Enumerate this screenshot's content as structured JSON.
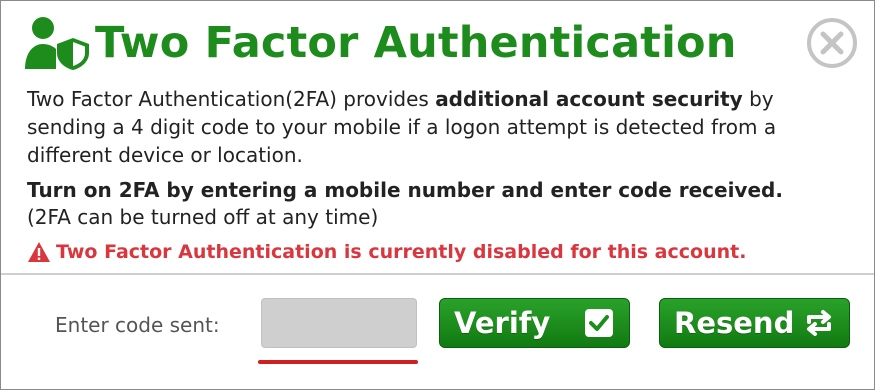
{
  "dialog": {
    "title": "Two Factor Authentication",
    "header_icon": "user-shield-icon",
    "close_icon": "close-circle-icon"
  },
  "description": {
    "part1": "Two Factor Authentication(2FA) provides ",
    "bold1": "additional account security",
    "part2": " by sending a 4 digit code to your mobile if a logon attempt is detected from a different device or location."
  },
  "instructions": {
    "bold": "Turn on 2FA by entering a mobile number and enter code received.",
    "note": "(2FA can be turned off at any time)"
  },
  "warning": {
    "icon": "warning-triangle-icon",
    "text": "Two Factor Authentication is currently disabled for this account."
  },
  "code_entry": {
    "label": "Enter code sent:",
    "value": "",
    "placeholder": ""
  },
  "buttons": {
    "verify_label": "Verify",
    "verify_icon": "checkbox-check-icon",
    "resend_label": "Resend",
    "resend_icon": "repeat-arrows-icon"
  },
  "colors": {
    "title_green": "#1d8c1d",
    "button_green": "#1b8e1b",
    "warning_red": "#d9363e",
    "input_underline_red": "#d11f1f",
    "input_gray": "#cfcfcf"
  }
}
